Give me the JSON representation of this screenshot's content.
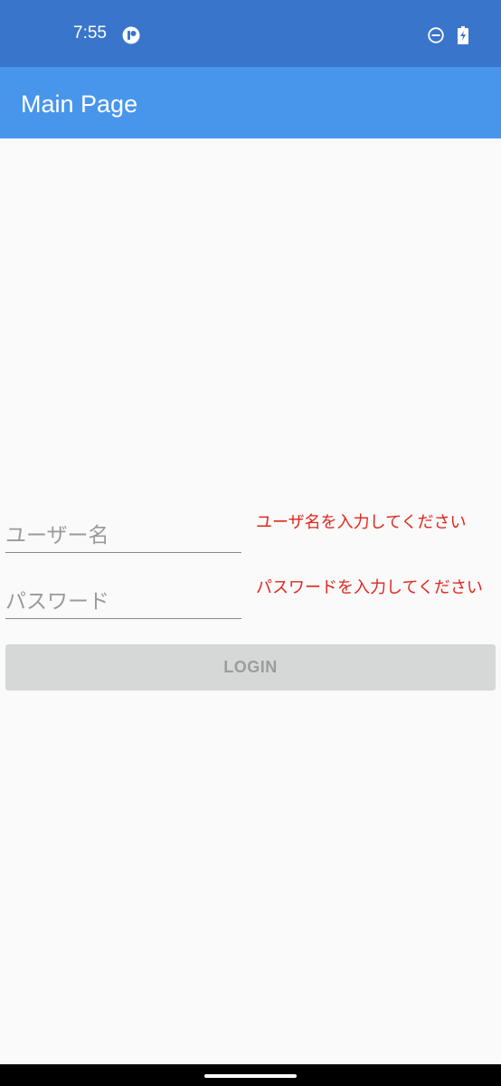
{
  "status_bar": {
    "time": "7:55",
    "app_icon": "app-notification-icon",
    "dnd_icon": "do-not-disturb-icon",
    "battery_icon": "battery-charging-icon"
  },
  "app_bar": {
    "title": "Main Page",
    "color": "#4896ec"
  },
  "form": {
    "username_placeholder": "ユーザー名",
    "username_value": "",
    "username_error": "ユーザ名を入力してください",
    "password_placeholder": "パスワード",
    "password_value": "",
    "password_error": "パスワードを入力してください",
    "login_label": "LOGIN",
    "error_color": "#e0261c"
  }
}
